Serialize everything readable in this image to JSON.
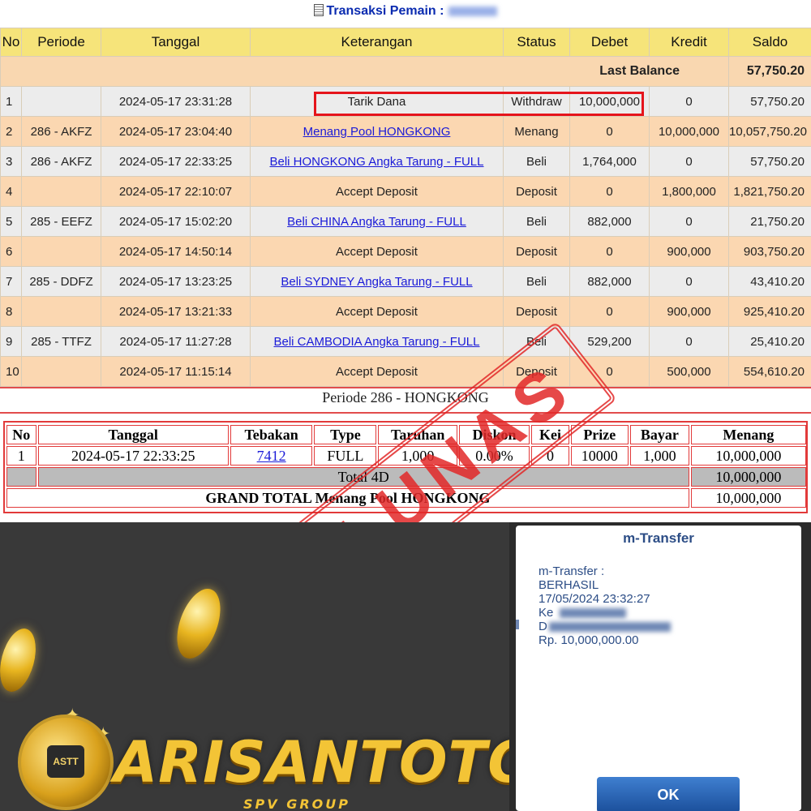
{
  "header": {
    "title": "Transaksi  Pemain :"
  },
  "transactions": {
    "columns": [
      "No",
      "Periode",
      "Tanggal",
      "Keterangan",
      "Status",
      "Debet",
      "Kredit",
      "Saldo"
    ],
    "last_balance_label": "Last Balance",
    "last_balance_value": "57,750.20",
    "rows": [
      {
        "no": "1",
        "periode": "",
        "tanggal": "2024-05-17 23:31:28",
        "keterangan": "Tarik Dana",
        "status": "Withdraw",
        "debet": "10,000,000",
        "kredit": "0",
        "saldo": "57,750.20"
      },
      {
        "no": "2",
        "periode": "286 - AKFZ",
        "tanggal": "2024-05-17 23:04:40",
        "keterangan": "Menang Pool HONGKONG",
        "status": "Menang",
        "debet": "0",
        "kredit": "10,000,000",
        "saldo": "10,057,750.20"
      },
      {
        "no": "3",
        "periode": "286 - AKFZ",
        "tanggal": "2024-05-17 22:33:25",
        "keterangan": "Beli HONGKONG Angka Tarung - FULL",
        "status": "Beli",
        "debet": "1,764,000",
        "kredit": "0",
        "saldo": "57,750.20"
      },
      {
        "no": "4",
        "periode": "",
        "tanggal": "2024-05-17 22:10:07",
        "keterangan": "Accept Deposit",
        "status": "Deposit",
        "debet": "0",
        "kredit": "1,800,000",
        "saldo": "1,821,750.20"
      },
      {
        "no": "5",
        "periode": "285 - EEFZ",
        "tanggal": "2024-05-17 15:02:20",
        "keterangan": "Beli CHINA Angka Tarung - FULL",
        "status": "Beli",
        "debet": "882,000",
        "kredit": "0",
        "saldo": "21,750.20"
      },
      {
        "no": "6",
        "periode": "",
        "tanggal": "2024-05-17 14:50:14",
        "keterangan": "Accept Deposit",
        "status": "Deposit",
        "debet": "0",
        "kredit": "900,000",
        "saldo": "903,750.20"
      },
      {
        "no": "7",
        "periode": "285 - DDFZ",
        "tanggal": "2024-05-17 13:23:25",
        "keterangan": "Beli SYDNEY Angka Tarung - FULL",
        "status": "Beli",
        "debet": "882,000",
        "kredit": "0",
        "saldo": "43,410.20"
      },
      {
        "no": "8",
        "periode": "",
        "tanggal": "2024-05-17 13:21:33",
        "keterangan": "Accept Deposit",
        "status": "Deposit",
        "debet": "0",
        "kredit": "900,000",
        "saldo": "925,410.20"
      },
      {
        "no": "9",
        "periode": "285 - TTFZ",
        "tanggal": "2024-05-17 11:27:28",
        "keterangan": "Beli CAMBODIA Angka Tarung - FULL",
        "status": "Beli",
        "debet": "529,200",
        "kredit": "0",
        "saldo": "25,410.20"
      },
      {
        "no": "10",
        "periode": "",
        "tanggal": "2024-05-17 11:15:14",
        "keterangan": "Accept Deposit",
        "status": "Deposit",
        "debet": "0",
        "kredit": "500,000",
        "saldo": "554,610.20"
      }
    ]
  },
  "periode": {
    "title": "Periode 286 - HONGKONG",
    "columns": [
      "No",
      "Tanggal",
      "Tebakan",
      "Type",
      "Taruhan",
      "Diskon",
      "Kei",
      "Prize",
      "Bayar",
      "Menang"
    ],
    "row": {
      "no": "1",
      "tanggal": "2024-05-17 22:33:25",
      "tebakan": "7412",
      "type": "FULL",
      "taruhan": "1,000",
      "diskon": "0.00%",
      "kei": "0",
      "prize": "10000",
      "bayar": "1,000",
      "menang": "10,000,000"
    },
    "total_label": "Total 4D",
    "total_value": "10,000,000",
    "grand_total_label": "GRAND TOTAL  Menang Pool HONGKONG",
    "grand_total_value": "10,000,000"
  },
  "stamp": {
    "text": "LUNAS"
  },
  "promo": {
    "brand": "ARISANTOTO",
    "sub": "SPV GROUP",
    "emblem": "ASTT"
  },
  "transfer": {
    "title": "m-Transfer",
    "line1": "m-Transfer :",
    "line2": "BERHASIL",
    "line3": "17/05/2024 23:32:27",
    "line4": "Ke",
    "line5": "D",
    "line6": "Rp. 10,000,000.00",
    "ok_label": "OK"
  }
}
